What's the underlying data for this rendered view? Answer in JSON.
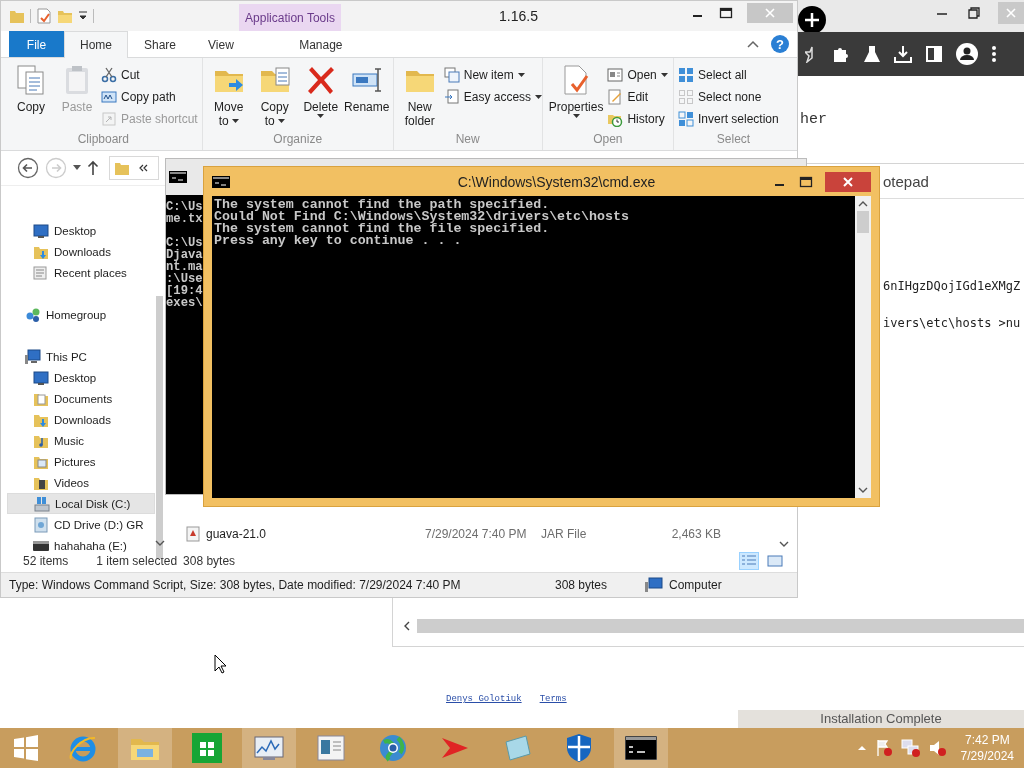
{
  "browser": {
    "page_fragment": "her",
    "footer_links": [
      "Denys Golotiuk",
      "Terms"
    ]
  },
  "notepad": {
    "title": "otepad",
    "lines": [
      "6nIHgzDQojIGd1eXMgZ",
      "ivers\\etc\\hosts >nu"
    ]
  },
  "explorer": {
    "title": "1.16.5",
    "contextual_tab": "Application Tools",
    "help": "?",
    "tabs": [
      {
        "label": "File",
        "kind": "file",
        "selected": false
      },
      {
        "label": "Home",
        "kind": "tab",
        "selected": true
      },
      {
        "label": "Share",
        "kind": "tab",
        "selected": false
      },
      {
        "label": "View",
        "kind": "tab",
        "selected": false
      },
      {
        "label": "Manage",
        "kind": "contextual",
        "selected": false
      }
    ],
    "ribbon_groups": [
      {
        "label": "Clipboard",
        "large": [
          {
            "lines": [
              "Copy"
            ],
            "kind": "copy",
            "disabled": false,
            "dropdown": false
          },
          {
            "lines": [
              "Paste"
            ],
            "kind": "paste",
            "disabled": true,
            "dropdown": false
          }
        ],
        "small": [
          {
            "label": "Cut",
            "kind": "cut",
            "disabled": false,
            "dropdown": false
          },
          {
            "label": "Copy path",
            "kind": "copypath",
            "disabled": false,
            "dropdown": false
          },
          {
            "label": "Paste shortcut",
            "kind": "pasteshortcut",
            "disabled": true,
            "dropdown": false
          }
        ]
      },
      {
        "label": "Organize",
        "large": [
          {
            "lines": [
              "Move",
              "to"
            ],
            "kind": "moveto",
            "disabled": false,
            "dropdown": true
          },
          {
            "lines": [
              "Copy",
              "to"
            ],
            "kind": "copyto",
            "disabled": false,
            "dropdown": true
          },
          {
            "lines": [
              "Delete"
            ],
            "kind": "delete",
            "disabled": false,
            "dropdown": true
          },
          {
            "lines": [
              "Rename"
            ],
            "kind": "rename",
            "disabled": false,
            "dropdown": false
          }
        ]
      },
      {
        "label": "New",
        "large": [
          {
            "lines": [
              "New",
              "folder"
            ],
            "kind": "newfolder",
            "disabled": false,
            "dropdown": false
          }
        ],
        "small": [
          {
            "label": "New item",
            "kind": "newitem",
            "disabled": false,
            "dropdown": true
          },
          {
            "label": "Easy access",
            "kind": "easyaccess",
            "disabled": false,
            "dropdown": true
          }
        ]
      },
      {
        "label": "Open",
        "large": [
          {
            "lines": [
              "Properties"
            ],
            "kind": "properties",
            "disabled": false,
            "dropdown": true
          }
        ],
        "small": [
          {
            "label": "Open",
            "kind": "open",
            "disabled": false,
            "dropdown": true
          },
          {
            "label": "Edit",
            "kind": "edit",
            "disabled": false,
            "dropdown": false
          },
          {
            "label": "History",
            "kind": "history",
            "disabled": false,
            "dropdown": false
          }
        ]
      },
      {
        "label": "Select",
        "small": [
          {
            "label": "Select all",
            "kind": "selectall",
            "disabled": false,
            "dropdown": false
          },
          {
            "label": "Select none",
            "kind": "selectnone",
            "disabled": false,
            "dropdown": false
          },
          {
            "label": "Invert selection",
            "kind": "invert",
            "disabled": false,
            "dropdown": false
          }
        ]
      }
    ],
    "nav_items": [
      {
        "label": "Desktop",
        "kind": "desktop",
        "selected": false
      },
      {
        "label": "Downloads",
        "kind": "downloads",
        "selected": false
      },
      {
        "label": "Recent places",
        "kind": "recent",
        "selected": false
      },
      {
        "label": "Homegroup",
        "kind": "homegroup",
        "selected": false
      },
      {
        "label": "This PC",
        "kind": "pc",
        "selected": false,
        "children": [
          {
            "label": "Desktop",
            "kind": "desktop",
            "selected": false
          },
          {
            "label": "Documents",
            "kind": "documents",
            "selected": false
          },
          {
            "label": "Downloads",
            "kind": "downloads",
            "selected": false
          },
          {
            "label": "Music",
            "kind": "music",
            "selected": false
          },
          {
            "label": "Pictures",
            "kind": "pictures",
            "selected": false
          },
          {
            "label": "Videos",
            "kind": "videos",
            "selected": false
          },
          {
            "label": "Local Disk (C:)",
            "kind": "disk",
            "selected": true
          },
          {
            "label": "CD Drive (D:) GR",
            "kind": "cd",
            "selected": false
          },
          {
            "label": "hahahaha (E:)",
            "kind": "drive",
            "selected": false
          }
        ]
      }
    ],
    "files": [
      {
        "name": "guava-21.0",
        "date": "7/29/2024 7:40 PM",
        "type": "JAR File",
        "size": "2,463 KB"
      }
    ],
    "status": {
      "items": "52 items",
      "selected": "1 item selected",
      "size": "308 bytes"
    },
    "views": [
      {
        "kind": "details",
        "selected": true
      },
      {
        "kind": "tiles",
        "selected": false
      }
    ],
    "details_bar": {
      "text": "Type: Windows Command Script, Size: 308 bytes, Date modified: 7/29/2024 7:40 PM",
      "size": "308 bytes",
      "location": "Computer"
    }
  },
  "cmd_back": {
    "blocks": [
      [
        "C:\\Us",
        "me.tx"
      ],
      [
        "C:\\Us",
        "Djava",
        "nt.ma",
        ":\\Use",
        "[19:4",
        "exes\\"
      ]
    ]
  },
  "cmd": {
    "title": "C:\\Windows\\System32\\cmd.exe",
    "lines": [
      "The system cannot find the path specified.",
      "Could Not Find C:\\Windows\\System32\\drivers\\etc\\hosts",
      "The system cannot find the file specified.",
      "Press any key to continue . . ."
    ]
  },
  "taskbar": {
    "apps": [
      {
        "kind": "start",
        "active": false
      },
      {
        "kind": "browser",
        "active": false
      },
      {
        "kind": "files",
        "active": true
      },
      {
        "kind": "store",
        "active": false
      },
      {
        "kind": "monitor",
        "active": true
      },
      {
        "kind": "document",
        "active": false
      },
      {
        "kind": "globe",
        "active": false
      },
      {
        "kind": "arrow",
        "active": false
      },
      {
        "kind": "notepad",
        "active": false
      },
      {
        "kind": "shield",
        "active": false
      },
      {
        "kind": "console",
        "active": true
      }
    ],
    "time": "7:42 PM",
    "date": "7/29/2024"
  },
  "toast": {
    "title": "Installation Complete"
  }
}
